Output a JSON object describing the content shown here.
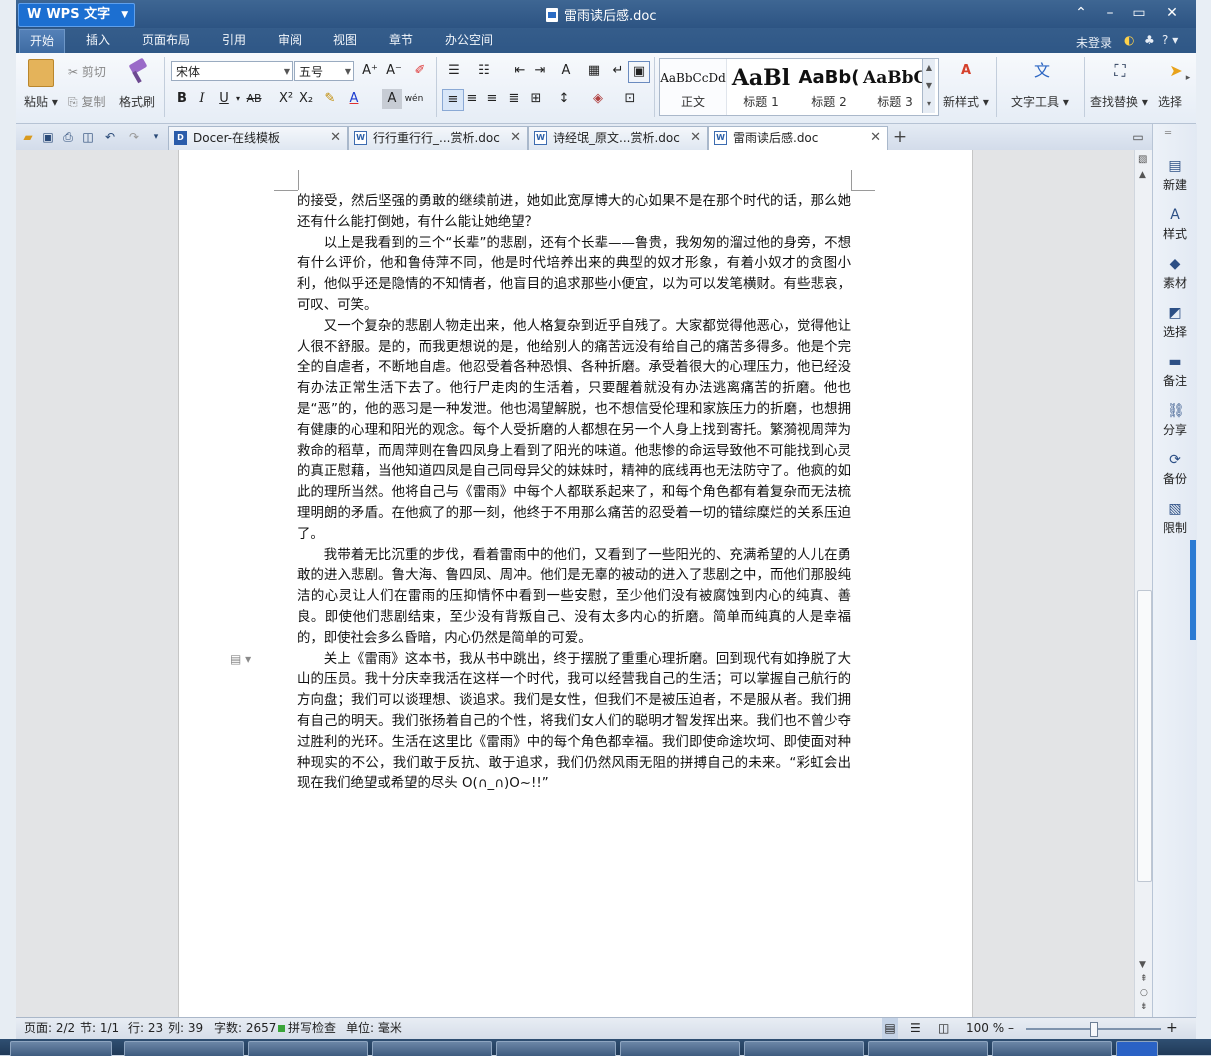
{
  "app": {
    "name": "WPS 文字",
    "document_title": "雷雨读后感.doc"
  },
  "menu": {
    "tabs": [
      "开始",
      "插入",
      "页面布局",
      "引用",
      "审阅",
      "视图",
      "章节",
      "办公空间"
    ],
    "active_tab": "开始",
    "login": "未登录",
    "help": "?"
  },
  "ribbon": {
    "paste": "粘贴",
    "cut": "剪切",
    "copy": "复制",
    "format_painter": "格式刷",
    "font_name": "宋体",
    "font_size": "五号",
    "styles": [
      {
        "sample": "AaBbCcDd",
        "name": "正文"
      },
      {
        "sample": "AaBl",
        "name": "标题 1"
      },
      {
        "sample": "AaBb(",
        "name": "标题 2"
      },
      {
        "sample": "AaBbC",
        "name": "标题 3"
      }
    ],
    "new_style": "新样式",
    "text_tools": "文字工具",
    "find_replace": "查找替换",
    "select": "选择"
  },
  "tabs": [
    {
      "label": "Docer-在线模板",
      "active": false
    },
    {
      "label": "行行重行行_...赏析.doc",
      "active": false
    },
    {
      "label": "诗经氓_原文...赏析.doc",
      "active": false
    },
    {
      "label": "雷雨读后感.doc",
      "active": true
    }
  ],
  "document": {
    "paragraphs": [
      {
        "indent": false,
        "text": "的接受，然后坚强的勇敢的继续前进，她如此宽厚博大的心如果不是在那个时代的话，那么她还有什么能打倒她，有什么能让她绝望？"
      },
      {
        "indent": true,
        "text": "以上是我看到的三个“长辈”的悲剧，还有个长辈——鲁贵，我匆匆的溜过他的身旁，不想有什么评价，他和鲁侍萍不同，他是时代培养出来的典型的奴才形象，有着小奴才的贪图小利，他似乎还是隐情的不知情者，他盲目的追求那些小便宜，以为可以发笔横财。有些悲哀，可叹、可笑。"
      },
      {
        "indent": true,
        "text": "又一个复杂的悲剧人物走出来，他人格复杂到近乎自残了。大家都觉得他恶心，觉得他让人很不舒服。是的，而我更想说的是，他给别人的痛苦远没有给自己的痛苦多得多。他是个完全的自虐者，不断地自虐。他忍受着各种恐惧、各种折磨。承受着很大的心理压力，他已经没有办法正常生活下去了。他行尸走肉的生活着，只要醒着就没有办法逃离痛苦的折磨。他也是“恶”的，他的恶习是一种发泄。他也渴望解脱，也不想信受伦理和家族压力的折磨，也想拥有健康的心理和阳光的观念。每个人受折磨的人都想在另一个人身上找到寄托。繁漪视周萍为救命的稻草，而周萍则在鲁四凤身上看到了阳光的味道。他悲惨的命运导致他不可能找到心灵的真正慰藉，当他知道四凤是自己同母异父的妹妹时，精神的底线再也无法防守了。他疯的如此的理所当然。他将自己与《雷雨》中每个人都联系起来了，和每个角色都有着复杂而无法梳理明朗的矛盾。在他疯了的那一刻，他终于不用那么痛苦的忍受着一切的错综糜烂的关系压迫了。"
      },
      {
        "indent": true,
        "text": "我带着无比沉重的步伐，看着雷雨中的他们，又看到了一些阳光的、充满希望的人儿在勇敢的进入悲剧。鲁大海、鲁四凤、周冲。他们是无辜的被动的进入了悲剧之中，而他们那股纯洁的心灵让人们在雷雨的压抑情怀中看到一些安慰，至少他们没有被腐蚀到内心的纯真、善良。即使他们悲剧结束，至少没有背叛自己、没有太多内心的折磨。简单而纯真的人是幸福的，即使社会多么昏暗，内心仍然是简单的可爱。"
      },
      {
        "indent": true,
        "text": "关上《雷雨》这本书，我从书中跳出，终于摆脱了重重心理折磨。回到现代有如挣脱了大山的压员。我十分庆幸我活在这样一个时代，我可以经营我自己的生活；可以掌握自己航行的方向盘；我们可以谈理想、谈追求。我们是女性，但我们不是被压迫者，不是服从者。我们拥有自己的明天。我们张扬着自己的个性，将我们女人们的聪明才智发挥出来。我们也不曾少夺过胜利的光环。生活在这里比《雷雨》中的每个角色都幸福。我们即使命途坎坷、即使面对种种现实的不公，我们敢于反抗、敢于追求，我们仍然风雨无阻的拼搏自己的未来。“彩虹会出现在我们绝望或希望的尽头 O(∩_∩)O~!!”"
      }
    ]
  },
  "taskpane": [
    "新建",
    "样式",
    "素材",
    "选择",
    "备注",
    "分享",
    "备份",
    "限制"
  ],
  "status": {
    "page": "页面: 2/2",
    "section": "节: 1/1",
    "line": "行: 23",
    "column": "列: 39",
    "word_count": "字数: 2657",
    "spell_check": "拼写检查",
    "unit": "单位: 毫米",
    "zoom": "100 %",
    "zoom_fraction": 0.5
  },
  "colors": {
    "title_bar": "#3e6693",
    "app_badge": "#1c6fd1",
    "ribbon_bg": "#eef3f9"
  }
}
